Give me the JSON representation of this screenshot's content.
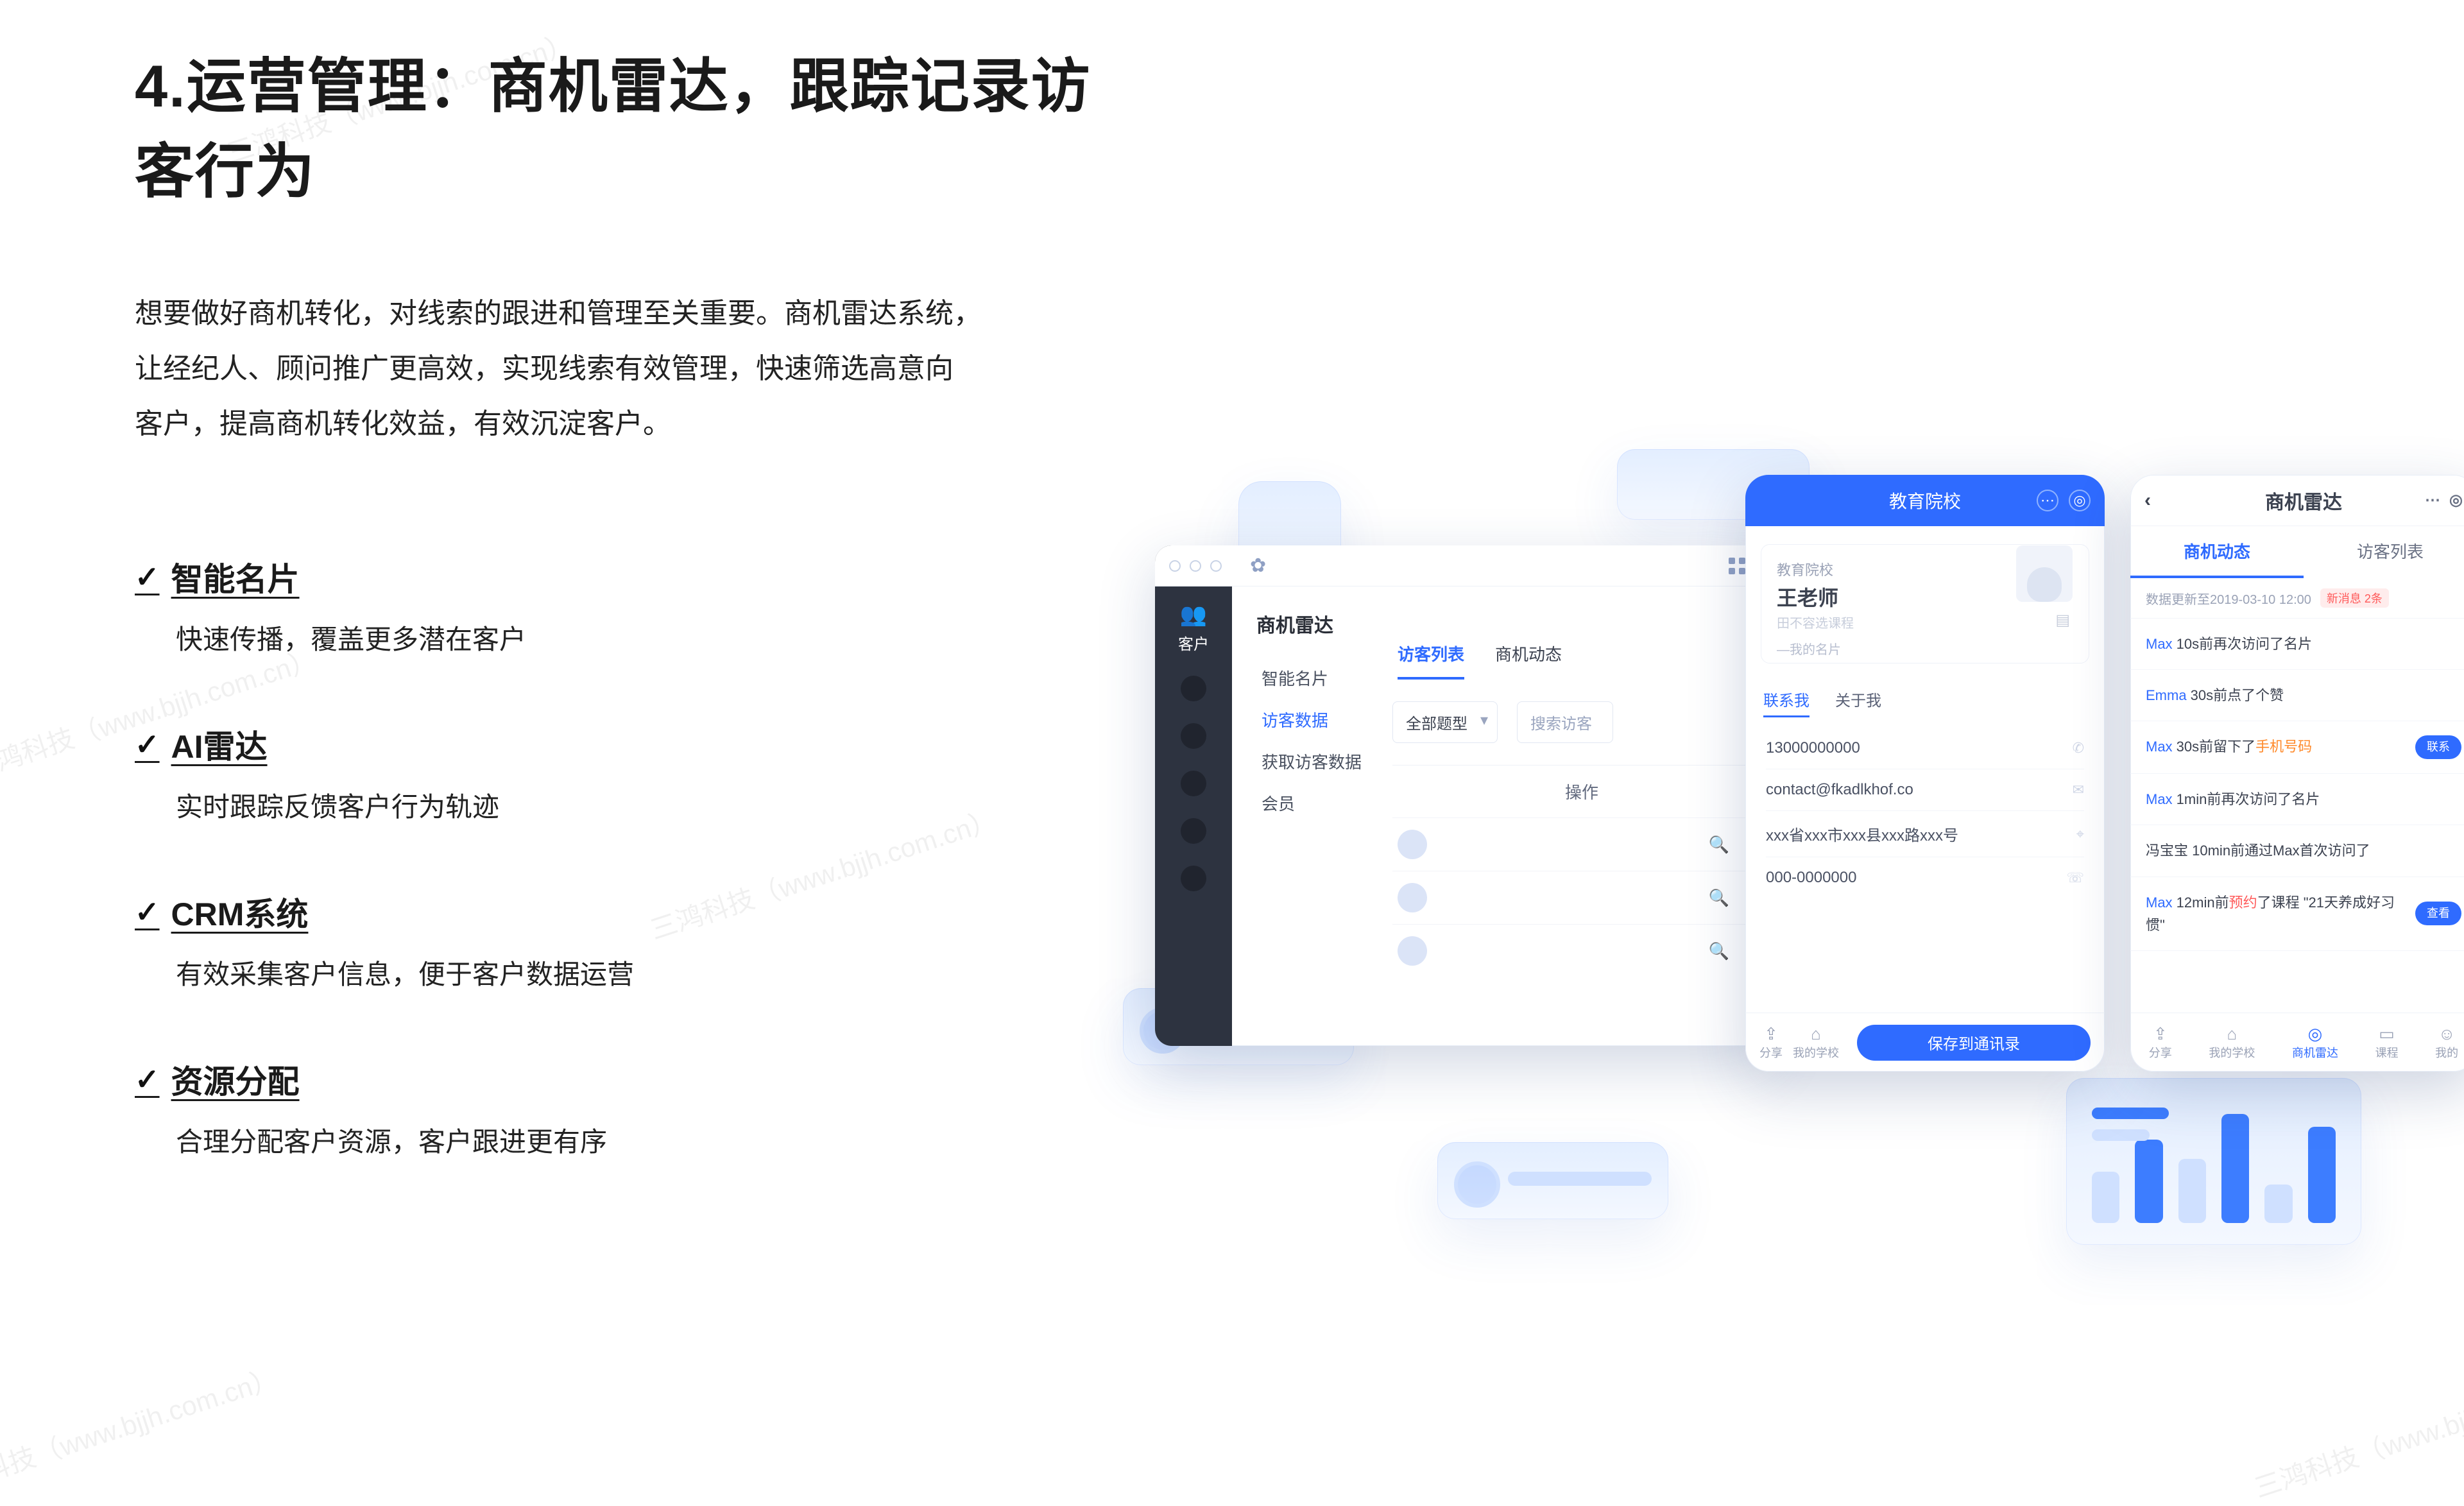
{
  "watermark": "三鸿科技（www.bjjh.com.cn）",
  "title": "4.运营管理：商机雷达，跟踪记录访客行为",
  "intro": [
    "想要做好商机转化，对线索的跟进和管理至关重要。商机雷达系统，",
    "让经纪人、顾问推广更高效，实现线索有效管理，快速筛选高意向",
    "客户，提高商机转化效益，有效沉淀客户。"
  ],
  "features": [
    {
      "title": "智能名片",
      "sub": "快速传播，覆盖更多潜在客户"
    },
    {
      "title": "AI雷达",
      "sub": "实时跟踪反馈客户行为轨迹"
    },
    {
      "title": "CRM系统",
      "sub": "有效采集客户信息，便于客户数据运营"
    },
    {
      "title": "资源分配",
      "sub": "合理分配客户资源，客户跟进更有序"
    }
  ],
  "desk": {
    "side_label": "客户",
    "nav_header": "商机雷达",
    "nav": [
      "智能名片",
      "访客数据",
      "获取访客数据",
      "会员"
    ],
    "nav_active_index": 1,
    "tabs": [
      "访客列表",
      "商机动态"
    ],
    "tab_active_index": 0,
    "filter_select": "全部题型",
    "filter_search_ph": "搜索访客",
    "table_header": "操作"
  },
  "phone1": {
    "header": "教育院校",
    "org": "教育院校",
    "name": "王老师",
    "subtitle": "田不容选课程",
    "chip": "—我的名片",
    "tab1": "联系我",
    "tab2": "关于我",
    "rows": [
      {
        "v": "13000000000",
        "icon": "phone-icon"
      },
      {
        "v": "contact@fkadlkhof.co",
        "icon": "mail-icon"
      },
      {
        "v": "xxx省xxx市xxx县xxx路xxx号",
        "icon": "pin-icon"
      },
      {
        "v": "000-0000000",
        "icon": "phone2-icon"
      }
    ],
    "bottom": {
      "a": "分享",
      "b": "我的学校",
      "cta": "保存到通讯录"
    }
  },
  "phone2": {
    "header": "商机雷达",
    "tabs": [
      "商机动态",
      "访客列表"
    ],
    "tab_active_index": 0,
    "meta_label": "数据更新至2019-03-10 12:00",
    "meta_pill": "新消息 2条",
    "events": [
      {
        "html_a": "Max",
        "mid": " 10s前再次访问了名片",
        "badge": ""
      },
      {
        "html_a": "Emma",
        "mid": " 30s前点了个赞",
        "badge": ""
      },
      {
        "html_a": "Max",
        "mid": " 30s前留下了",
        "tail": "手机号码",
        "tail_cls": "org",
        "badge": "联系"
      },
      {
        "html_a": "Max",
        "mid": " 1min前再次访问了名片",
        "badge": ""
      },
      {
        "html_a": "冯宝宝",
        "a_cls": "",
        "mid": " 10min前通过Max首次访问了",
        "badge": ""
      },
      {
        "html_a": "Max",
        "mid": " 12min前",
        "tail": "预约",
        "tail_cls": "rd",
        "post": "了课程 \"21天养成好习惯\"",
        "badge": "查看"
      }
    ],
    "bottom": [
      "分享",
      "我的学校",
      "商机雷达",
      "课程",
      "我的"
    ]
  },
  "chart": {
    "bars": [
      80,
      130,
      100,
      170,
      60,
      150
    ],
    "colors": [
      "#cfe0ff",
      "#3d7dff",
      "#cfe0ff",
      "#3d7dff",
      "#cfe0ff",
      "#3d7dff"
    ]
  }
}
